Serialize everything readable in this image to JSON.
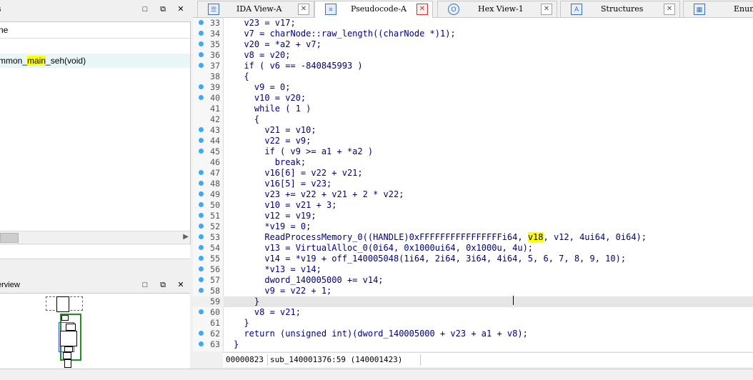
{
  "functions_pane": {
    "title": "s",
    "column_header": "ne",
    "row_prefix": "mmon_",
    "row_highlight": "main",
    "row_suffix": "_seh(void)"
  },
  "overview_pane": {
    "title": "erview"
  },
  "tabs": [
    {
      "label": "IDA View-A",
      "active": false
    },
    {
      "label": "Pseudocode-A",
      "active": true
    },
    {
      "label": "Hex View-1",
      "active": false
    },
    {
      "label": "Structures",
      "active": false
    },
    {
      "label": "Enums",
      "active": false
    }
  ],
  "code_lines": [
    {
      "n": "33",
      "dot": true,
      "text": "  v23 = v17;"
    },
    {
      "n": "34",
      "dot": true,
      "text": "  v7 = charNode::raw_length((charNode *)1);"
    },
    {
      "n": "35",
      "dot": true,
      "text": "  v20 = *a2 + v7;"
    },
    {
      "n": "36",
      "dot": true,
      "text": "  v8 = v20;"
    },
    {
      "n": "37",
      "dot": true,
      "text": "  if ( v6 == -840845993 )"
    },
    {
      "n": "38",
      "dot": false,
      "text": "  {"
    },
    {
      "n": "39",
      "dot": true,
      "text": "    v9 = 0;"
    },
    {
      "n": "40",
      "dot": true,
      "text": "    v10 = v20;"
    },
    {
      "n": "41",
      "dot": false,
      "text": "    while ( 1 )"
    },
    {
      "n": "42",
      "dot": false,
      "text": "    {"
    },
    {
      "n": "43",
      "dot": true,
      "text": "      v21 = v10;"
    },
    {
      "n": "44",
      "dot": true,
      "text": "      v22 = v9;"
    },
    {
      "n": "45",
      "dot": true,
      "text": "      if ( v9 >= a1 + *a2 )"
    },
    {
      "n": "46",
      "dot": false,
      "text": "        break;"
    },
    {
      "n": "47",
      "dot": true,
      "text": "      v16[6] = v22 + v21;"
    },
    {
      "n": "48",
      "dot": true,
      "text": "      v16[5] = v23;"
    },
    {
      "n": "49",
      "dot": true,
      "text": "      v23 += v22 + v21 + 2 * v22;"
    },
    {
      "n": "50",
      "dot": true,
      "text": "      v10 = v21 + 3;"
    },
    {
      "n": "51",
      "dot": true,
      "text": "      v12 = v19;"
    },
    {
      "n": "52",
      "dot": true,
      "text": "      *v19 = 0;"
    },
    {
      "n": "53",
      "dot": true,
      "text": "      ReadProcessMemory_0((HANDLE)0xFFFFFFFFFFFFFFFFi64, ",
      "hl": "v18",
      "text_after": ", v12, 4ui64, 0i64);"
    },
    {
      "n": "54",
      "dot": true,
      "text": "      v13 = VirtualAlloc_0(0i64, 0x1000ui64, 0x1000u, 4u);"
    },
    {
      "n": "55",
      "dot": true,
      "text": "      v14 = *v19 + off_140005048(1i64, 2i64, 3i64, 4i64, 5, 6, 7, 8, 9, 10);"
    },
    {
      "n": "56",
      "dot": true,
      "text": "      *v13 = v14;"
    },
    {
      "n": "57",
      "dot": true,
      "text": "      dword_140005000 += v14;"
    },
    {
      "n": "58",
      "dot": true,
      "text": "      v9 = v22 + 1;"
    },
    {
      "n": "59",
      "dot": false,
      "text": "    }",
      "current": true
    },
    {
      "n": "60",
      "dot": true,
      "text": "    v8 = v21;"
    },
    {
      "n": "61",
      "dot": false,
      "text": "  }"
    },
    {
      "n": "62",
      "dot": true,
      "text": "  return (unsigned int)(dword_140005000 + v23 + a1 + v8);"
    },
    {
      "n": "63",
      "dot": true,
      "text": "}"
    }
  ],
  "status_bar": {
    "offset": "00000823",
    "location": "sub_140001376:59 (140001423)"
  },
  "colors": {
    "code_text": "#000080",
    "highlight": "#ffff00",
    "breakpoint_dot": "#3fa9f5",
    "current_line": "#e6e6e6"
  }
}
